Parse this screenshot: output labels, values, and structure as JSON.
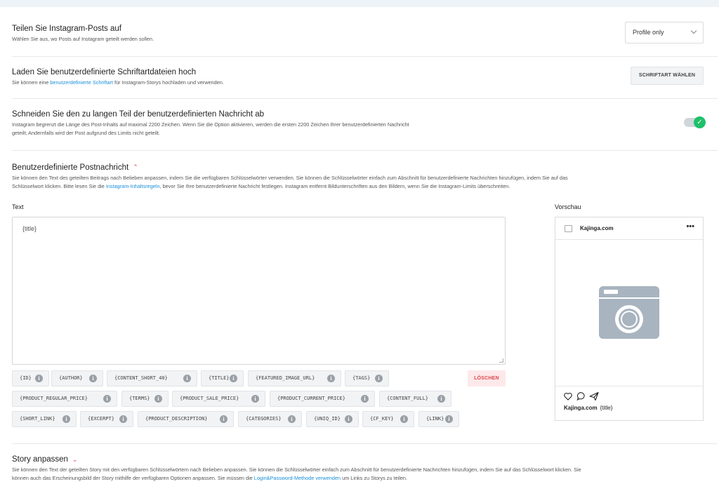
{
  "share": {
    "title": "Teilen Sie Instagram-Posts auf",
    "desc": "Wählen Sie aus, wo Posts auf Instagram geteilt werden sollen.",
    "select_value": "Profile only"
  },
  "fonts": {
    "title": "Laden Sie benutzerdefinierte Schriftartdateien hoch",
    "desc_before": "Sie können eine ",
    "desc_link": "benutzerdefinierte Schriftart",
    "desc_after": " für Instagram-Storys hochladen und verwenden.",
    "button": "SCHRIFTART WÄHLEN"
  },
  "truncate": {
    "title": "Schneiden Sie den zu langen Teil der benutzerdefinierten Nachricht ab",
    "desc_line1": "Instagram begrenzt die Länge des Post-Inhalts auf maximal 2200 Zeichen. Wenn Sie die Option aktivieren, werden die ersten 2200 Zeichen Ihrer benutzerdefinierten Nachricht",
    "desc_line2": "geteilt; Andernfalls wird der Post aufgrund des Limits nicht geteilt.",
    "toggle_on": true
  },
  "custom_message": {
    "title": "Benutzerdefinierte Postnachricht",
    "desc_line1": "Sie können den Text des geteilten Beitrags nach Belieben anpassen, indem Sie die verfügbaren Schlüsselwörter verwenden. Sie können die Schlüsselwörter einfach zum Abschnitt für benutzerdefinierte Nachrichten hinzufügen, indem Sie auf das",
    "desc_line2_before": "Schlüsselwort klicken. Bitte lesen Sie die ",
    "desc_link": "Instagram-Inhaltsregeln",
    "desc_line2_after": ", bevor Sie Ihre benutzerdefinierte Nachricht festlegen. Instagram entfernt Bildunterschriften aus den Bildern, wenn Sie die Instagram-Limits überschreiten.",
    "text_label": "Text",
    "text_value": "{title}",
    "preview_label": "Vorschau",
    "clear_button": "LÖSCHEN",
    "tags": [
      "{ID}",
      "{AUTHOR}",
      "{CONTENT_SHORT_40}",
      "{TITLE}",
      "{FEATURED_IMAGE_URL}",
      "{TAGS}",
      "{PRODUCT_REGULAR_PRICE}",
      "{TERMS}",
      "{PRODUCT_SALE_PRICE}",
      "{PRODUCT_CURRENT_PRICE}",
      "{CONTENT_FULL}",
      "{SHORT_LINK}",
      "{EXCERPT}",
      "{PRODUCT_DESCRIPTION}",
      "{CATEGORIES}",
      "{UNIQ_ID}",
      "{CF_KEY}",
      "{LINK}"
    ],
    "info_glyph": "i"
  },
  "preview": {
    "account": "Kajinga.com",
    "dots": "•••",
    "caption_account": "Kajinga.com",
    "caption_text": "{title}"
  },
  "story": {
    "title": "Story anpassen",
    "desc_line1": "Sie können den Text der geteilten Story mit den verfügbaren Schlüsselwörtern nach Belieben anpassen. Sie können die Schlüsselwörter einfach zum Abschnitt für benutzerdefinierte Nachrichten hinzufügen, indem Sie auf das Schlüsselwort klicken. Sie",
    "desc_line2_before": "können auch das Erscheinungsbild der Story mithilfe der verfügbaren Optionen anpassen. Sie müssen die ",
    "desc_link": "Login&Password-Methode verwenden",
    "desc_line2_after": " um Links zu Storys zu teilen."
  },
  "colors": {
    "accent_link": "#1b8fd9",
    "toggle_on": "#1ec16b",
    "danger": "#e0454a",
    "camera": "#a8b4bf"
  }
}
